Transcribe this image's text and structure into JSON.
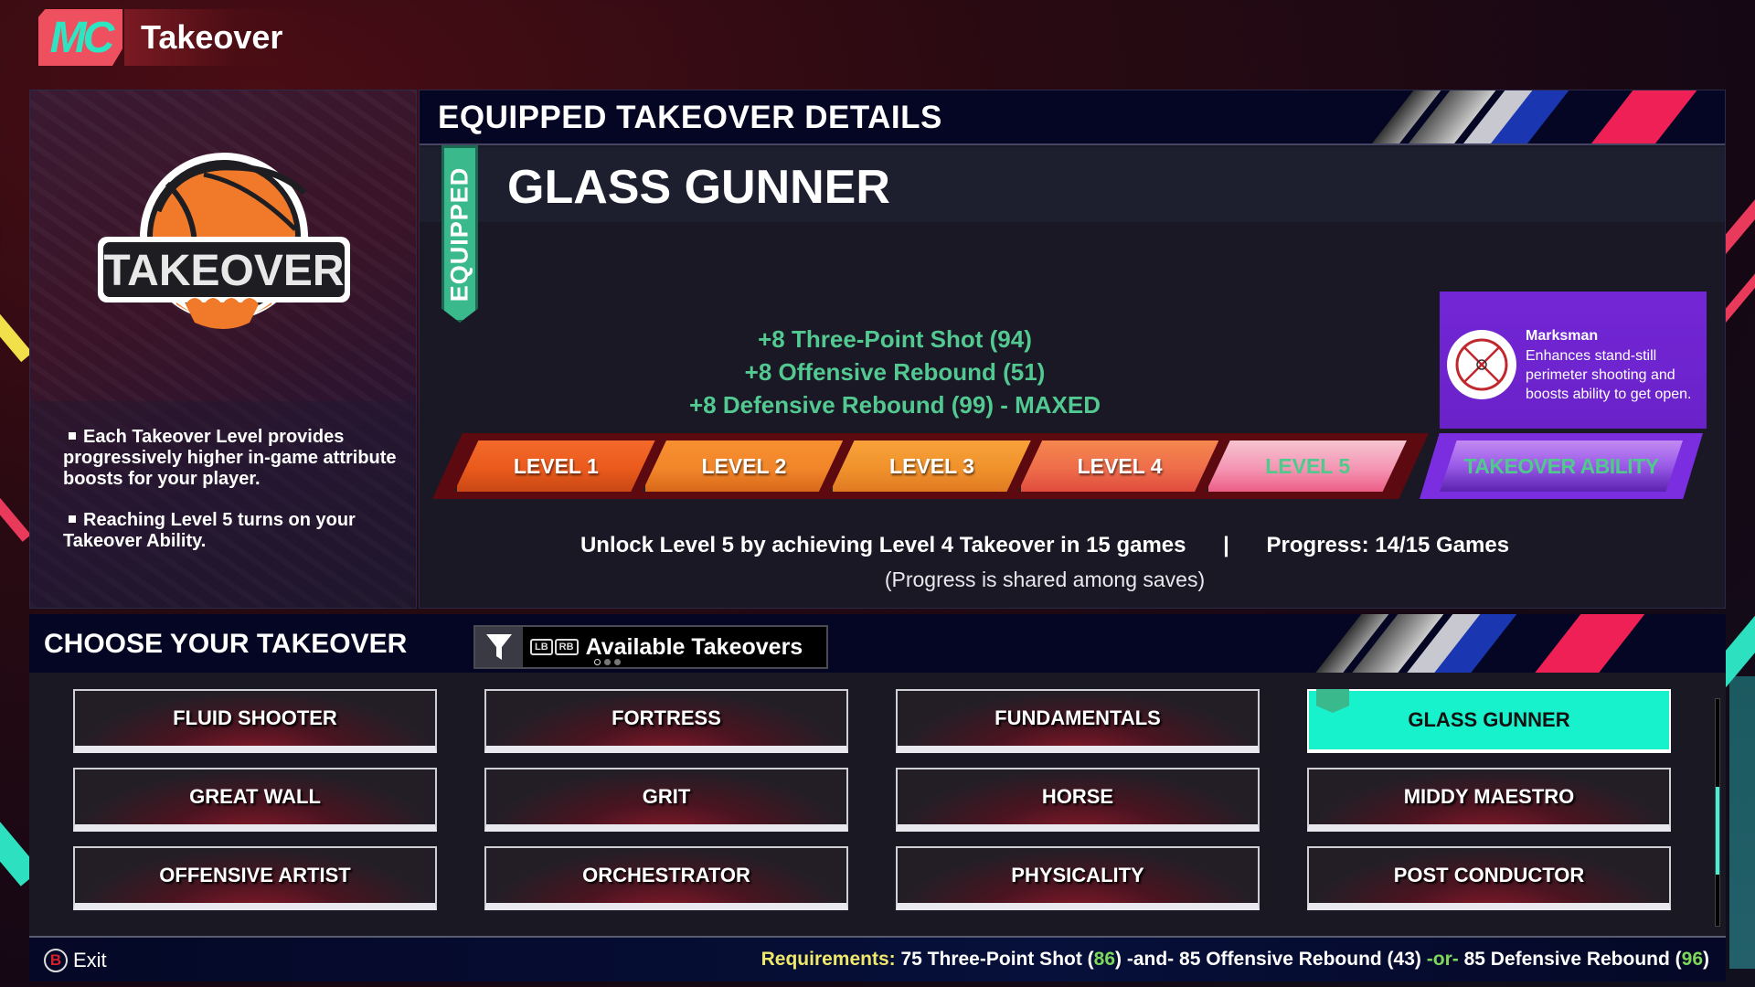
{
  "app": {
    "badge": "MC",
    "title": "Takeover"
  },
  "left_panel": {
    "logo_text": "TAKEOVER",
    "info": [
      "Each Takeover Level provides progressively higher in-game attribute boosts for your player.",
      "Reaching Level 5 turns on your Takeover Ability."
    ]
  },
  "details": {
    "header": "EQUIPPED TAKEOVER DETAILS",
    "equipped_label": "EQUIPPED",
    "takeover_name": "GLASS GUNNER",
    "boosts": [
      "+8 Three-Point Shot (94)",
      "+8 Offensive Rebound (51)",
      "+8 Defensive Rebound (99) - MAXED"
    ],
    "levels": [
      {
        "label": "LEVEL 1",
        "unlocked": true
      },
      {
        "label": "LEVEL 2",
        "unlocked": true
      },
      {
        "label": "LEVEL 3",
        "unlocked": true
      },
      {
        "label": "LEVEL 4",
        "unlocked": true
      },
      {
        "label": "LEVEL 5",
        "unlocked": false
      }
    ],
    "ability_tab": "TAKEOVER ABILITY",
    "ability": {
      "icon": "crosshair-icon",
      "name": "Marksman",
      "description": "Enhances stand-still perimeter shooting and boosts ability to get open."
    },
    "unlock_text": "Unlock Level 5 by achieving Level 4 Takeover in 15 games",
    "separator": "|",
    "progress_text": "Progress: 14/15 Games",
    "progress": {
      "current": 14,
      "total": 15
    },
    "shared_note": "(Progress is shared among saves)"
  },
  "choose": {
    "header": "CHOOSE YOUR TAKEOVER",
    "filter": {
      "icon": "filter-icon",
      "bumper_left": "LB",
      "bumper_right": "RB",
      "label": "Available Takeovers",
      "page_dots": 3,
      "active_dot": 0
    },
    "takeovers": [
      {
        "label": "FLUID SHOOTER",
        "selected": false
      },
      {
        "label": "FORTRESS",
        "selected": false
      },
      {
        "label": "FUNDAMENTALS",
        "selected": false
      },
      {
        "label": "GLASS GUNNER",
        "selected": true
      },
      {
        "label": "GREAT WALL",
        "selected": false
      },
      {
        "label": "GRIT",
        "selected": false
      },
      {
        "label": "HORSE",
        "selected": false
      },
      {
        "label": "MIDDY MAESTRO",
        "selected": false
      },
      {
        "label": "OFFENSIVE ARTIST",
        "selected": false
      },
      {
        "label": "ORCHESTRATOR",
        "selected": false
      },
      {
        "label": "PHYSICALITY",
        "selected": false
      },
      {
        "label": "POST CONDUCTOR",
        "selected": false
      }
    ]
  },
  "footer": {
    "exit_button_glyph": "B",
    "exit_label": "Exit",
    "requirements_label": "Requirements:",
    "req_part1": "75 Three-Point Shot (",
    "req_val1": "86",
    "req_part2": ") -and- 85 Offensive Rebound (43) ",
    "req_or": "-or-",
    "req_part3": " 85 Defensive Rebound (",
    "req_val3": "96",
    "req_part4": ")"
  },
  "colors": {
    "accent_teal": "#18f2cc",
    "boost_green": "#53c992",
    "ability_purple": "#7326d6",
    "requirements_yellow": "#efe86a",
    "met_green": "#7ed85a",
    "brand_red": "#ee5060"
  }
}
